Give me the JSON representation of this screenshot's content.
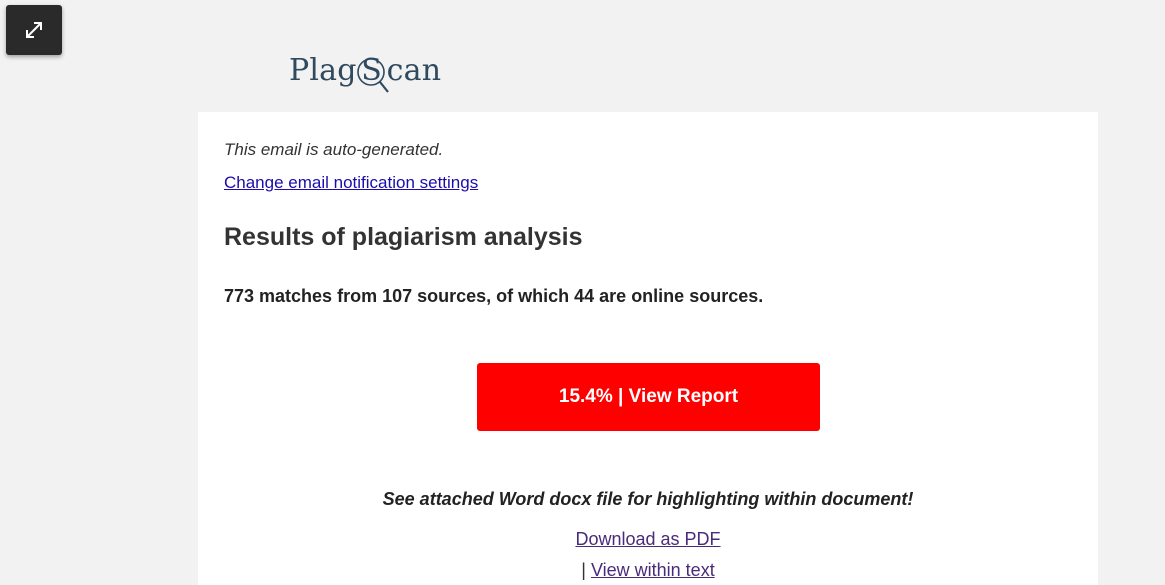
{
  "toolbar": {
    "expand_icon": "expand-diagonal-icon"
  },
  "logo": {
    "prefix": "Plag",
    "s_letter": "S",
    "suffix": "can",
    "color": "#2f4a5e"
  },
  "email": {
    "auto_note": "This email is auto-generated.",
    "settings_link": "Change email notification settings",
    "title": "Results of plagiarism analysis",
    "summary": "773 matches from 107 sources, of which 44 are online sources.",
    "report_button": "15.4% | View Report",
    "report_button_color": "#ff0000",
    "attach_note": "See attached Word docx file for highlighting within document!",
    "download_pdf": "Download as PDF",
    "separator": "| ",
    "view_within_text": "View within text"
  }
}
